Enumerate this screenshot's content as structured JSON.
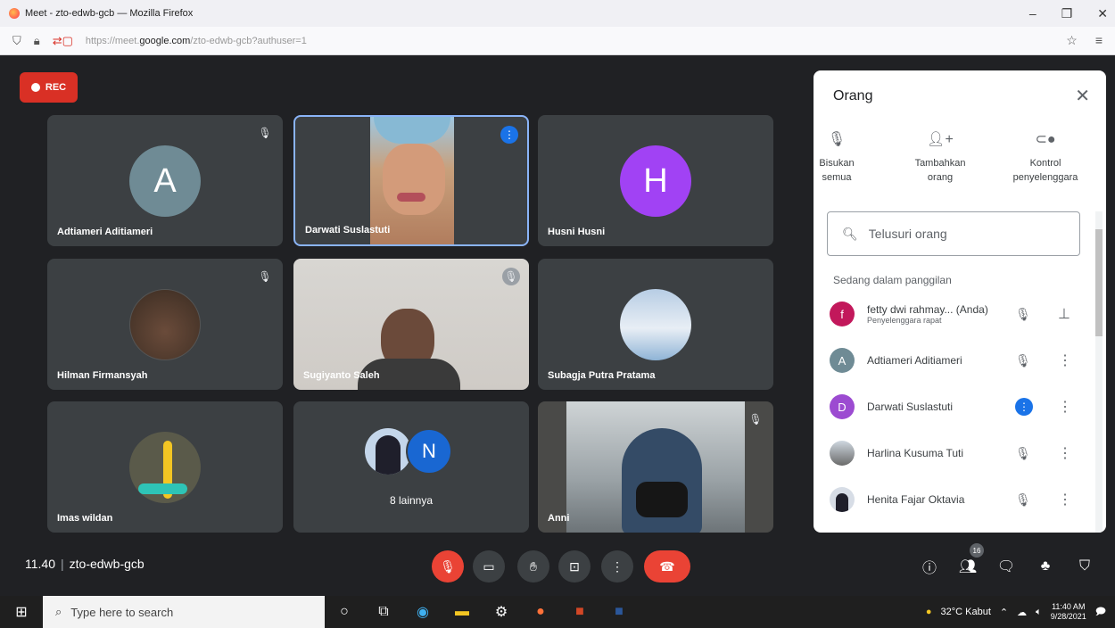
{
  "window": {
    "title": "Meet - zto-edwb-gcb — Mozilla Firefox"
  },
  "urlbar": {
    "url_prefix": "https://meet.",
    "url_domain": "google.com",
    "url_path": "/zto-edwb-gcb?authuser=1"
  },
  "meet": {
    "rec_label": "REC",
    "time": "11.40",
    "code": "zto-edwb-gcb",
    "tiles": [
      {
        "name": "Adtiameri Aditiameri",
        "initial": "A",
        "color": "#6f8b95"
      },
      {
        "name": "Darwati Suslastuti"
      },
      {
        "name": "Husni Husni",
        "initial": "H",
        "color": "#a142f4"
      },
      {
        "name": "Hilman Firmansyah"
      },
      {
        "name": "Sugiyanto Saleh"
      },
      {
        "name": "Subagja Putra Pratama"
      },
      {
        "name": "Imas wildan"
      },
      {
        "name": "8 lainnya",
        "initial": "N"
      },
      {
        "name": "Anni"
      }
    ],
    "participants_badge": "16"
  },
  "panel": {
    "title": "Orang",
    "actions": [
      {
        "label1": "Bisukan",
        "label2": "semua"
      },
      {
        "label1": "Tambahkan",
        "label2": "orang"
      },
      {
        "label1": "Kontrol",
        "label2": "penyelenggara"
      }
    ],
    "search_placeholder": "Telusuri orang",
    "section": "Sedang dalam panggilan",
    "people": [
      {
        "name": "fetty dwi rahmay... (Anda)",
        "sub": "Penyelenggara rapat",
        "initial": "f",
        "color": "#c2185b"
      },
      {
        "name": "Adtiameri Aditiameri",
        "initial": "A",
        "color": "#6f8b95"
      },
      {
        "name": "Darwati Suslastuti",
        "initial": "D",
        "color": "#9c4bd1"
      },
      {
        "name": "Harlina Kusuma Tuti"
      },
      {
        "name": "Henita Fajar Oktavia"
      }
    ]
  },
  "taskbar": {
    "search_placeholder": "Type here to search",
    "weather": "32°C Kabut",
    "time": "11:40 AM",
    "date": "9/28/2021"
  }
}
